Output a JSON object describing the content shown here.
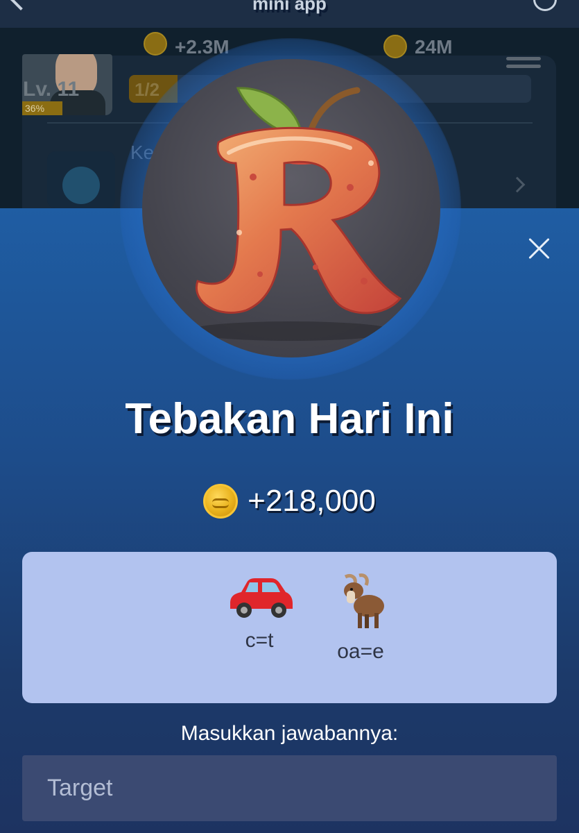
{
  "topbar": {
    "title": "mini app"
  },
  "background_app": {
    "level": "Lv. 11",
    "level_progress": "36%",
    "income_per_hour": "+2.3M",
    "coin_balance": "24M",
    "progress_text": "1/2",
    "task_label": "Ke"
  },
  "modal": {
    "title": "Tebakan Hari Ini",
    "reward": "+218,000",
    "clues": [
      {
        "emoji": "🚗",
        "hint": "c=t",
        "icon": "car-icon"
      },
      {
        "emoji": "🐐",
        "hint": "oa=e",
        "icon": "goat-icon"
      }
    ],
    "prompt": "Masukkan jawabannya:",
    "answer": {
      "value": "",
      "placeholder": "Target"
    }
  },
  "colors": {
    "sheet": "#1f5da3",
    "card": "#b2c3ef",
    "input": "#3b4a72",
    "coin": "#e9b21c"
  }
}
